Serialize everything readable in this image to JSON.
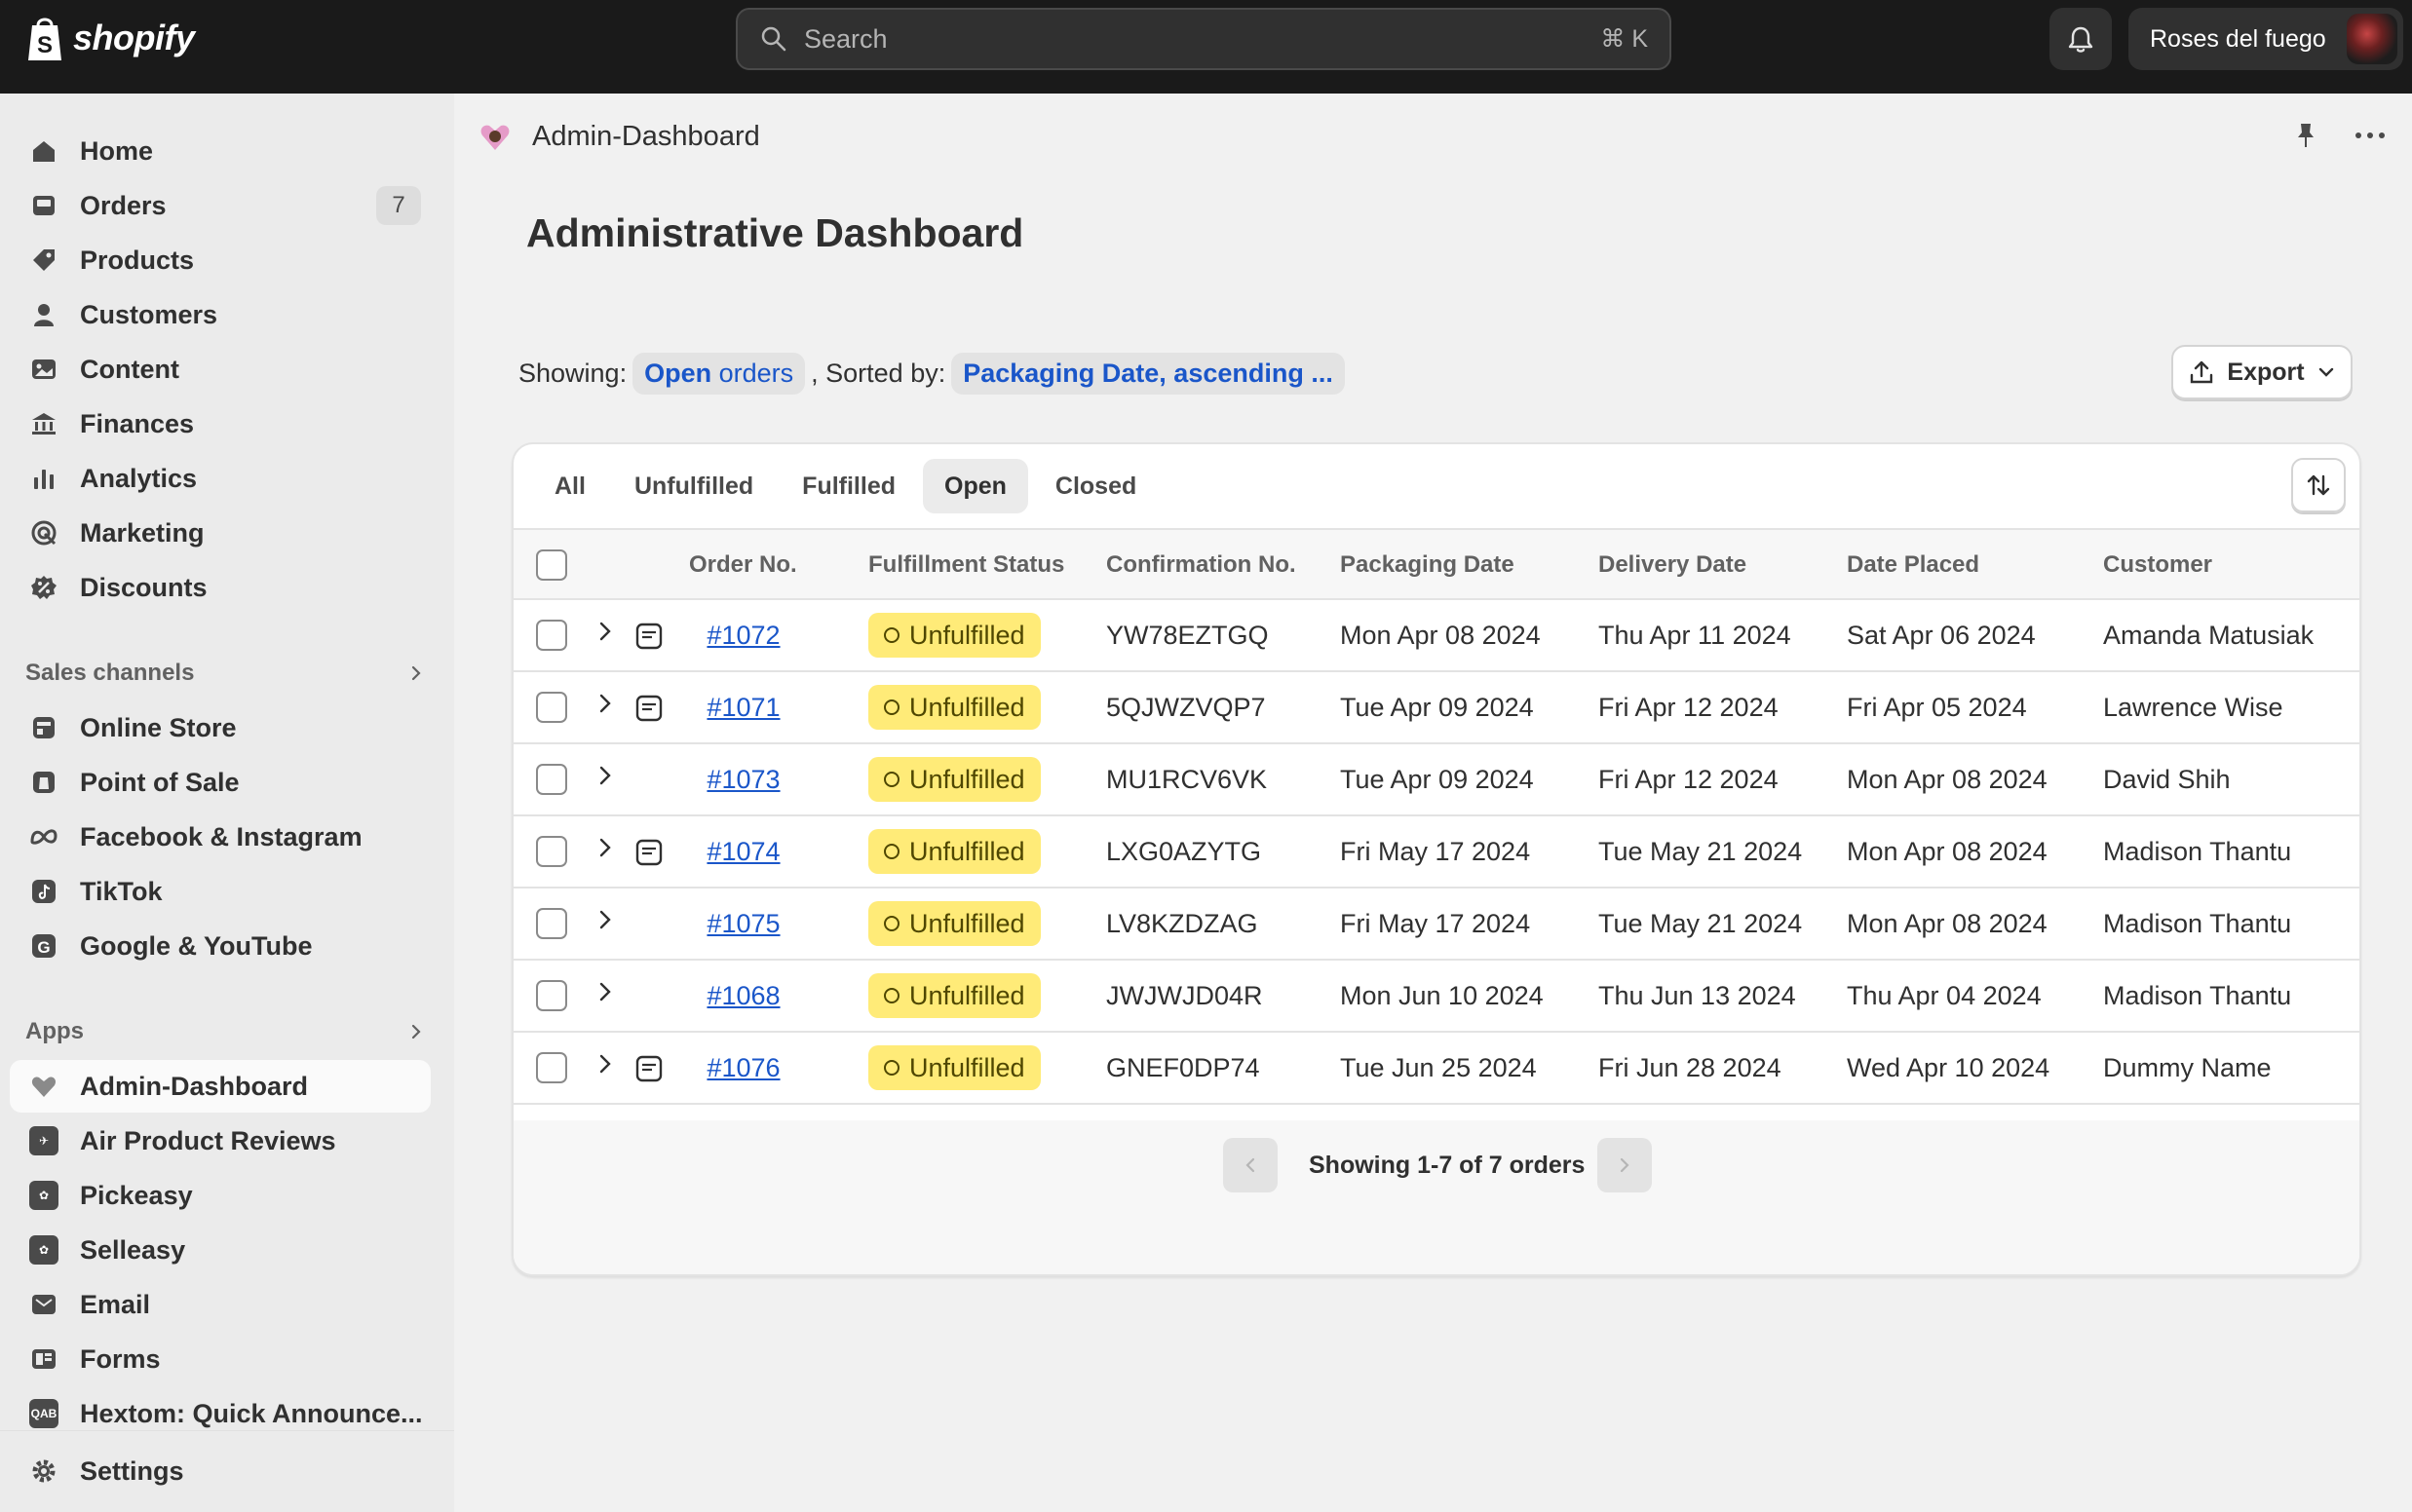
{
  "topbar": {
    "brand": "shopify",
    "search_placeholder": "Search",
    "search_shortcut": "⌘ K",
    "store_name": "Roses del fuego"
  },
  "sidebar": {
    "items": [
      {
        "label": "Home",
        "icon": "home-icon"
      },
      {
        "label": "Orders",
        "icon": "orders-icon",
        "badge": "7"
      },
      {
        "label": "Products",
        "icon": "tag-icon"
      },
      {
        "label": "Customers",
        "icon": "person-icon"
      },
      {
        "label": "Content",
        "icon": "content-icon"
      },
      {
        "label": "Finances",
        "icon": "bank-icon"
      },
      {
        "label": "Analytics",
        "icon": "bar-chart-icon"
      },
      {
        "label": "Marketing",
        "icon": "target-icon"
      },
      {
        "label": "Discounts",
        "icon": "discount-icon"
      }
    ],
    "sales_channels_label": "Sales channels",
    "sales_channels": [
      {
        "label": "Online Store",
        "icon": "store-icon"
      },
      {
        "label": "Point of Sale",
        "icon": "pos-icon"
      },
      {
        "label": "Facebook & Instagram",
        "icon": "meta-icon"
      },
      {
        "label": "TikTok",
        "icon": "tiktok-icon"
      },
      {
        "label": "Google & YouTube",
        "icon": "google-icon"
      }
    ],
    "apps_label": "Apps",
    "apps": [
      {
        "label": "Admin-Dashboard",
        "icon": "heart-app-icon",
        "active": true
      },
      {
        "label": "Air Product Reviews",
        "icon": "reviews-app-icon"
      },
      {
        "label": "Pickeasy",
        "icon": "pickeasy-app-icon"
      },
      {
        "label": "Selleasy",
        "icon": "selleasy-app-icon"
      },
      {
        "label": "Email",
        "icon": "email-icon"
      },
      {
        "label": "Forms",
        "icon": "forms-icon"
      },
      {
        "label": "Hextom: Quick Announce...",
        "icon": "qab-app-icon",
        "icon_text": "QAB"
      }
    ],
    "settings_label": "Settings"
  },
  "main": {
    "app_title": "Admin-Dashboard",
    "page_title": "Administrative Dashboard",
    "filter": {
      "showing_label": "Showing:",
      "showing_value_bold": "Open",
      "showing_value_light": "orders",
      "sorted_label": ", Sorted by:",
      "sorted_value": "Packaging Date, ascending ..."
    },
    "export_label": "Export",
    "tabs": [
      "All",
      "Unfulfilled",
      "Fulfilled",
      "Open",
      "Closed"
    ],
    "active_tab": "Open",
    "columns": [
      "Order No.",
      "Fulfillment Status",
      "Confirmation No.",
      "Packaging Date",
      "Delivery Date",
      "Date Placed",
      "Customer"
    ],
    "rows": [
      {
        "order": "#1072",
        "status": "Unfulfilled",
        "confirmation": "YW78EZTGQ",
        "packaging": "Mon Apr 08 2024",
        "delivery": "Thu Apr 11 2024",
        "placed": "Sat Apr 06 2024",
        "customer": "Amanda Matusiak",
        "has_note": true
      },
      {
        "order": "#1071",
        "status": "Unfulfilled",
        "confirmation": "5QJWZVQP7",
        "packaging": "Tue Apr 09 2024",
        "delivery": "Fri Apr 12 2024",
        "placed": "Fri Apr 05 2024",
        "customer": "Lawrence Wise",
        "has_note": true
      },
      {
        "order": "#1073",
        "status": "Unfulfilled",
        "confirmation": "MU1RCV6VK",
        "packaging": "Tue Apr 09 2024",
        "delivery": "Fri Apr 12 2024",
        "placed": "Mon Apr 08 2024",
        "customer": "David Shih",
        "has_note": false
      },
      {
        "order": "#1074",
        "status": "Unfulfilled",
        "confirmation": "LXG0AZYTG",
        "packaging": "Fri May 17 2024",
        "delivery": "Tue May 21 2024",
        "placed": "Mon Apr 08 2024",
        "customer": "Madison Thantu",
        "has_note": true
      },
      {
        "order": "#1075",
        "status": "Unfulfilled",
        "confirmation": "LV8KZDZAG",
        "packaging": "Fri May 17 2024",
        "delivery": "Tue May 21 2024",
        "placed": "Mon Apr 08 2024",
        "customer": "Madison Thantu",
        "has_note": false
      },
      {
        "order": "#1068",
        "status": "Unfulfilled",
        "confirmation": "JWJWJD04R",
        "packaging": "Mon Jun 10 2024",
        "delivery": "Thu Jun 13 2024",
        "placed": "Thu Apr 04 2024",
        "customer": "Madison Thantu",
        "has_note": false
      },
      {
        "order": "#1076",
        "status": "Unfulfilled",
        "confirmation": "GNEF0DP74",
        "packaging": "Tue Jun 25 2024",
        "delivery": "Fri Jun 28 2024",
        "placed": "Wed Apr 10 2024",
        "customer": "Dummy Name",
        "has_note": true
      }
    ],
    "pagination_text": "Showing 1-7 of 7 orders"
  },
  "colors": {
    "topbar": "#1a1a1a",
    "link": "#1a56c9",
    "status_badge": "#ffeb78",
    "sidebar": "#ebebeb"
  }
}
